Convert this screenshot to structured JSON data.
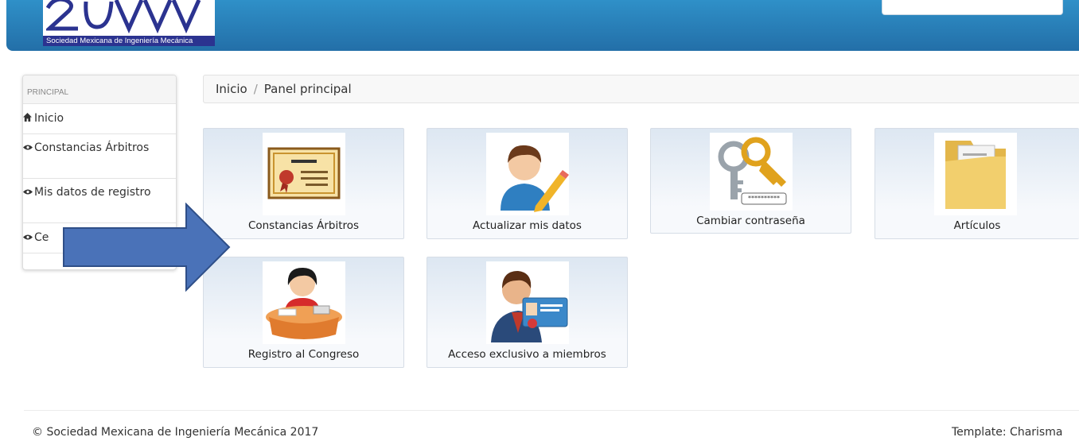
{
  "header": {
    "logo_text": "Sociedad Mexicana de Ingeniería Mecánica",
    "brand_color": "#2b7fbd"
  },
  "sidebar": {
    "section": "PRINCIPAL",
    "items": [
      {
        "label": "Inicio",
        "icon": "home-icon"
      },
      {
        "label": "Constancias Árbitros",
        "icon": "eye-icon"
      },
      {
        "label": "Mis datos de registro",
        "icon": "eye-icon"
      },
      {
        "label": "Ce",
        "icon": "eye-icon"
      }
    ]
  },
  "breadcrumb": {
    "home": "Inicio",
    "separator": "/",
    "current": "Panel principal"
  },
  "tiles": [
    {
      "label": "Constancias Árbitros",
      "icon": "certificate-icon"
    },
    {
      "label": "Actualizar mis datos",
      "icon": "user-edit-icon"
    },
    {
      "label": "Cambiar contraseña",
      "icon": "keys-icon",
      "password_mask": "**********"
    },
    {
      "label": "Artículos",
      "icon": "folder-icon"
    },
    {
      "label": "Registro al Congreso",
      "icon": "registration-icon"
    },
    {
      "label": "Acceso exclusivo a miembros",
      "icon": "member-card-icon"
    }
  ],
  "footer": {
    "copyright": "© Sociedad Mexicana de Ingeniería Mecánica 2017",
    "template": "Template: Charisma"
  }
}
